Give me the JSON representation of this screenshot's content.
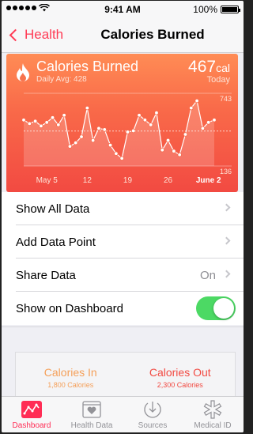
{
  "status_bar": {
    "time": "9:41 AM",
    "battery": "100%",
    "battery_level": 1.0
  },
  "nav": {
    "back_label": "Health",
    "title": "Calories Burned"
  },
  "card": {
    "title": "Calories Burned",
    "daily_avg": "Daily Avg: 428",
    "value": "467",
    "unit": "cal",
    "period": "Today",
    "colors": {
      "top": "#ff8c55",
      "bottom": "#f24a42"
    }
  },
  "chart_data": {
    "type": "line",
    "ylim": [
      136,
      743
    ],
    "y_ticks": [
      "743",
      "136"
    ],
    "average": 428,
    "x_ticks": [
      "May 5",
      "12",
      "19",
      "26",
      "June 2"
    ],
    "x_tick_days": [
      5,
      12,
      19,
      26,
      33
    ],
    "days": [
      1,
      2,
      3,
      4,
      5,
      6,
      7,
      8,
      9,
      10,
      11,
      12,
      13,
      14,
      15,
      16,
      17,
      18,
      19,
      20,
      21,
      22,
      23,
      24,
      25,
      26,
      27,
      28,
      29,
      30,
      31,
      32,
      33,
      34
    ],
    "values": [
      520,
      490,
      510,
      470,
      500,
      540,
      480,
      560,
      300,
      330,
      380,
      620,
      350,
      450,
      440,
      310,
      240,
      200,
      420,
      430,
      560,
      520,
      480,
      580,
      270,
      350,
      260,
      230,
      400,
      620,
      680,
      450,
      500,
      520
    ]
  },
  "list": {
    "items": [
      {
        "label": "Show All Data"
      },
      {
        "label": "Add Data Point"
      },
      {
        "label": "Share Data",
        "value": "On"
      },
      {
        "label": "Show on Dashboard",
        "toggle": true
      }
    ]
  },
  "summary": {
    "left": {
      "title": "Calories In",
      "sub": "1,800 Calories",
      "color": "#f5a05a"
    },
    "right": {
      "title": "Calories Out",
      "sub": "2,300 Calories",
      "color": "#f24a42"
    }
  },
  "tabs": [
    {
      "label": "Dashboard",
      "icon": "dashboard-icon",
      "active": true
    },
    {
      "label": "Health Data",
      "icon": "health-data-icon"
    },
    {
      "label": "Sources",
      "icon": "sources-icon"
    },
    {
      "label": "Medical ID",
      "icon": "medical-id-icon"
    }
  ]
}
